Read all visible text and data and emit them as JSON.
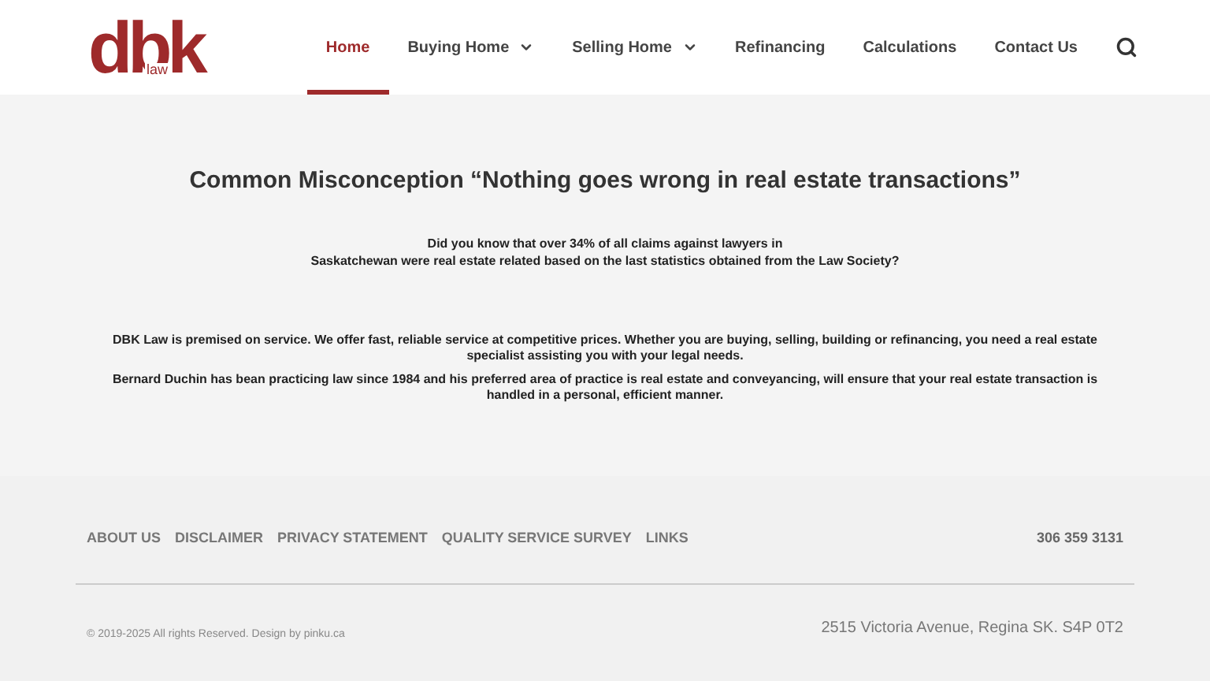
{
  "logo": {
    "letters": "dbk",
    "sub": "law"
  },
  "nav": [
    {
      "label": "Home",
      "selected": true,
      "dropdown": false
    },
    {
      "label": "Buying Home",
      "selected": false,
      "dropdown": true
    },
    {
      "label": "Selling Home",
      "selected": false,
      "dropdown": true
    },
    {
      "label": "Refinancing",
      "selected": false,
      "dropdown": false
    },
    {
      "label": "Calculations",
      "selected": false,
      "dropdown": false
    },
    {
      "label": "Contact Us",
      "selected": false,
      "dropdown": false
    }
  ],
  "heading": "Common Misconception “Nothing goes wrong in real estate transactions”",
  "intro": [
    "Did you know that over 34% of all claims against lawyers in",
    "Saskatchewan were real estate related based on the last statistics obtained from the Law Society?"
  ],
  "paragraphs": [
    "DBK Law is premised on service. We offer fast, reliable service at competitive prices. Whether you are buying, selling, building or refinancing, you need a real estate specialist assisting you with your legal needs.",
    "Bernard Duchin has bean practicing law since 1984 and his preferred area of practice is real estate and conveyancing, will ensure that your real estate transaction is handled in a personal, efficient manner."
  ],
  "footer": {
    "links": [
      "ABOUT US",
      "DISCLAIMER",
      "PRIVACY STATEMENT",
      "QUALITY SERVICE SURVEY",
      "LINKS"
    ],
    "phone": "306 359 3131",
    "copyright": "© 2019-2025 All rights Reserved. Design by pinku.ca",
    "address": "2515 Victoria Avenue, Regina SK. S4P 0T2"
  }
}
